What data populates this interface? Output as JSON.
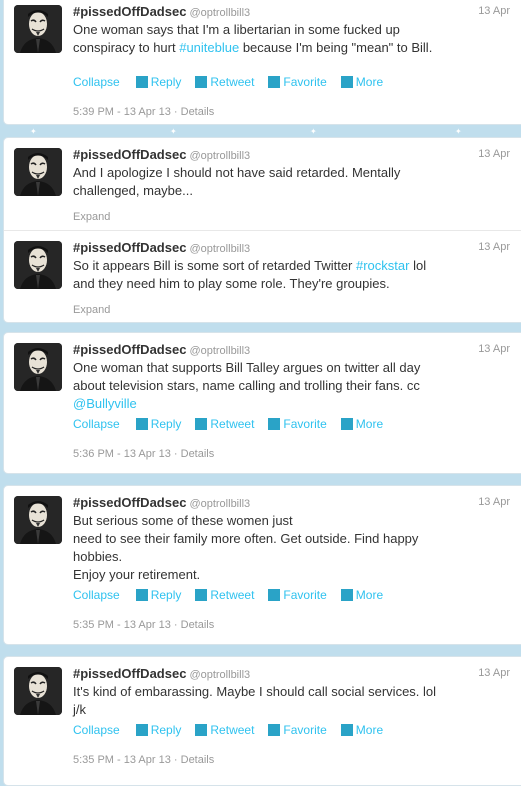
{
  "actions": {
    "collapse": "Collapse",
    "expand": "Expand",
    "reply": "Reply",
    "retweet": "Retweet",
    "favorite": "Favorite",
    "more": "More",
    "details": "Details"
  },
  "tweets": [
    {
      "name": "#pissedOffDadsec",
      "handle": "@optrollbill3",
      "date": "13 Apr",
      "lines": [
        [
          "One woman says that I'm a libertarian in some fucked up"
        ],
        [
          "conspiracy to hurt ",
          {
            "link": "#uniteblue"
          },
          " because I'm being \"mean\" to Bill."
        ]
      ],
      "timestamp": "5:39 PM - 13 Apr 13"
    },
    {
      "name": "#pissedOffDadsec",
      "handle": "@optrollbill3",
      "date": "13 Apr",
      "lines": [
        [
          "And I apologize I should not have said retarded. Mentally"
        ],
        [
          "challenged, maybe..."
        ]
      ]
    },
    {
      "name": "#pissedOffDadsec",
      "handle": "@optrollbill3",
      "date": "13 Apr",
      "lines": [
        [
          "So it appears Bill is some sort of retarded Twitter ",
          {
            "link": "#rockstar"
          },
          " lol"
        ],
        [
          "and they need him to play some role. They're groupies."
        ]
      ]
    },
    {
      "name": "#pissedOffDadsec",
      "handle": "@optrollbill3",
      "date": "13 Apr",
      "lines": [
        [
          "One woman that supports Bill Talley argues on twitter all day"
        ],
        [
          "about television stars, name calling and trolling their fans. cc"
        ],
        [
          {
            "link": "@Bullyville"
          }
        ]
      ],
      "timestamp": "5:36 PM - 13 Apr 13"
    },
    {
      "name": "#pissedOffDadsec",
      "handle": "@optrollbill3",
      "date": "13 Apr",
      "lines": [
        [
          "But serious some of these women just"
        ],
        [
          "need to see their family more often. Get outside. Find happy"
        ],
        [
          "hobbies."
        ],
        [
          "Enjoy your retirement."
        ]
      ],
      "timestamp": "5:35 PM - 13 Apr 13"
    },
    {
      "name": "#pissedOffDadsec",
      "handle": "@optrollbill3",
      "date": "13 Apr",
      "lines": [
        [
          "It's kind of embarassing. Maybe I should call social services. lol"
        ],
        [
          "j/k"
        ]
      ],
      "timestamp": "5:35 PM - 13 Apr 13"
    }
  ]
}
